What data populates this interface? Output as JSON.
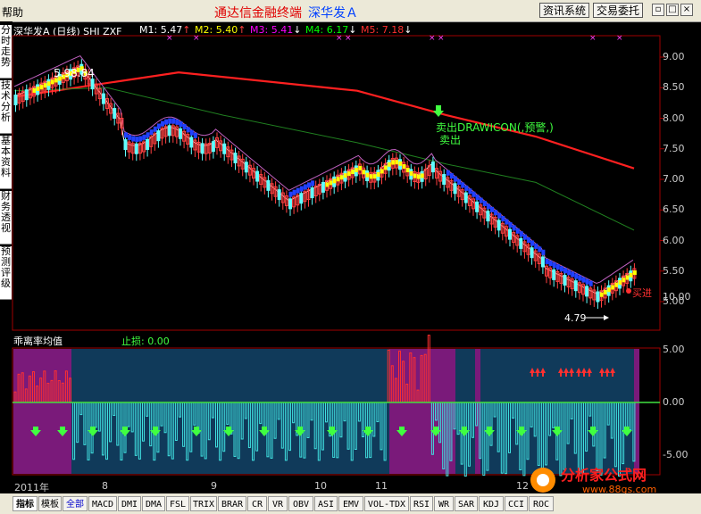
{
  "menu": {
    "help": "帮助"
  },
  "title": {
    "app": "通达信金融终端",
    "stock": "深华发Ａ"
  },
  "toolbar": {
    "news": "资讯系统",
    "trade": "交易委托",
    "win_min": "▫",
    "win_restore": "□",
    "win_close": "×"
  },
  "sidebar": {
    "tabs": [
      "分时走势",
      "技术分析",
      "基本资料",
      "财务透视",
      "预测评级"
    ]
  },
  "chart_header": {
    "label": "深华发A (日线) SHI ZXF",
    "ma": [
      {
        "name": "M1:",
        "value": "5.47",
        "arrow": "↑",
        "color": "#ffffff"
      },
      {
        "name": "M2:",
        "value": "5.40",
        "arrow": "↑",
        "color": "#ffff00"
      },
      {
        "name": "M3:",
        "value": "5.41",
        "arrow": "↓",
        "color": "#ff00ff"
      },
      {
        "name": "M4:",
        "value": "6.17",
        "arrow": "↓",
        "color": "#00ff00"
      },
      {
        "name": "M5:",
        "value": "7.18",
        "arrow": "↓",
        "color": "#ff3030"
      }
    ]
  },
  "annotations": {
    "high": "5.98.84",
    "sell_signal": "卖出DRAWICON(,预警,)",
    "sell": "卖出",
    "buy": "买进",
    "low_price": "4.79"
  },
  "main_y_ticks": [
    "9.00",
    "8.50",
    "8.00",
    "7.50",
    "7.00",
    "6.50",
    "6.00",
    "5.50",
    "5.00"
  ],
  "sub_panel": {
    "title": "乖离率均值",
    "stop_label": "止损:",
    "stop_value": "0.00"
  },
  "sub_y_ticks": [
    "10.00",
    "5.00",
    "0.00",
    "-5.00"
  ],
  "x_ticks": [
    "2011年",
    "8",
    "9",
    "10",
    "11",
    "12"
  ],
  "bottom_tabs": [
    "指标",
    "模板",
    "全部",
    "MACD",
    "DMI",
    "DMA",
    "FSL",
    "TRIX",
    "BRAR",
    "CR",
    "VR",
    "OBV",
    "ASI",
    "EMV",
    "VOL-TDX",
    "RSI",
    "WR",
    "SAR",
    "KDJ",
    "CCI",
    "ROC"
  ],
  "watermark": {
    "text": "分析家公式网",
    "url": "www.88gs.com"
  },
  "colors": {
    "price_line": "#ff2020",
    "ma_green": "#208020",
    "bias_bar": "#40e0e0",
    "bias_red": "#ff3030",
    "panel_blue": "#103a5a",
    "panel_purple": "#7a1a7a"
  }
}
